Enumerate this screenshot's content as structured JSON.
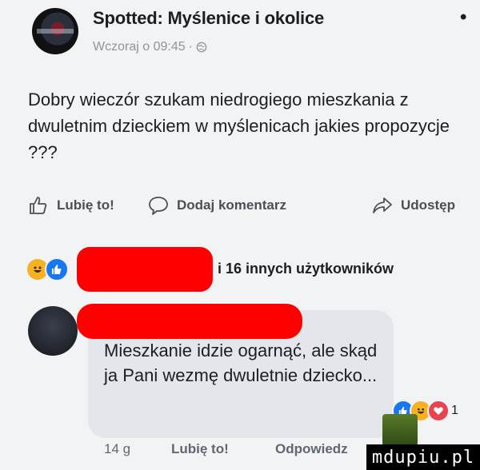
{
  "post": {
    "page_name": "Spotted: Myślenice i okolice",
    "timestamp": "Wczoraj o 09:45",
    "meta_separator": "·",
    "text": "Dobry wieczór szukam niedrogiego mieszkania z dwuletnim dzieckiem w myślenicach jakies propozycje ???"
  },
  "actions": {
    "like": "Lubię to!",
    "comment": "Dodaj komentarz",
    "share": "Udostęp"
  },
  "reactions": {
    "icons": [
      "haha-icon",
      "like-icon"
    ],
    "others_text": "i 16 innych użytkowników"
  },
  "comment": {
    "text": "Mieszkanie idzie ogarnąć, ale skąd ja Pani wezmę dwuletnie dziecko...",
    "reaction_count": "1",
    "time": "14 g",
    "like": "Lubię to!",
    "reply": "Odpowiedz"
  },
  "watermark": "mdupiu.pl",
  "colors": {
    "like_blue": "#1877f2",
    "haha_yellow": "#f7b125",
    "love_red": "#e9434f",
    "redaction": "#ff0000"
  }
}
